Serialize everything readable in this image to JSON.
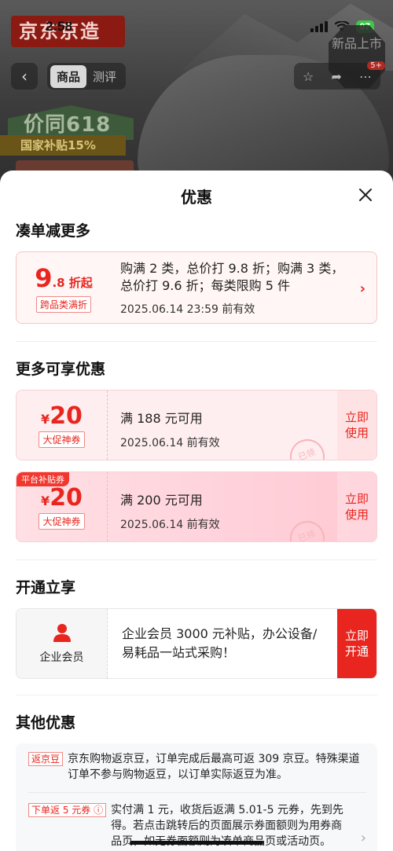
{
  "status_bar": {
    "time": "2:58",
    "battery": "97"
  },
  "product_page": {
    "logo": "京东京造",
    "new_badge": "新品上市",
    "back_icon": "chevron-left-icon",
    "tabs": [
      "商品",
      "测评"
    ],
    "msg_count": "5+",
    "price_banner": "价同618",
    "subsidy": "国家补贴15%"
  },
  "sheet": {
    "title": "优惠",
    "close_icon": "close-icon",
    "combo_section": {
      "title": "凑单减更多",
      "discount_int": "9",
      "discount_suffix": ".8 折起",
      "tag": "跨品类满折",
      "desc": "购满 2 类，总价打 9.8 折；购满 3 类，总价打 9.6 折；每类限购 5 件",
      "validity": "2025.06.14 23:59 前有效"
    },
    "more_section": {
      "title": "更多可享优惠",
      "coupons": [
        {
          "currency": "¥",
          "amount": "20",
          "tag": "大促神券",
          "condition": "满 188 元可用",
          "validity": "2025.06.14 前有效",
          "button": "立即使用",
          "stamp": "已领"
        },
        {
          "corner": "平台补贴券",
          "currency": "¥",
          "amount": "20",
          "tag": "大促神券",
          "condition": "满 200 元可用",
          "validity": "2025.06.14 前有效",
          "button": "立即使用",
          "stamp": "已领"
        }
      ]
    },
    "open_section": {
      "title": "开通立享",
      "member_label": "企业会员",
      "member_desc": "企业会员 3000 元补贴，办公设备/易耗品一站式采购！",
      "member_button": "立即开通"
    },
    "other_section": {
      "title": "其他优惠",
      "items": [
        {
          "tag": "返京豆",
          "text": "京东购物返京豆，订单完成后最高可返 309 京豆。特殊渠道订单不参与购物返豆，以订单实际返豆为准。"
        },
        {
          "tag": "下单返 5 元券 ⓘ",
          "text": "实付满 1 元，收货后返满 5.01-5 元券，先到先得。若点击跳转后的页面展示券面额则为用券商品页，如无券面额则为凑单商品页或活动页。"
        }
      ]
    }
  },
  "colors": {
    "accent": "#e8251e",
    "coupon_bg": "#ffeef0",
    "member_button": "#e8251e"
  }
}
